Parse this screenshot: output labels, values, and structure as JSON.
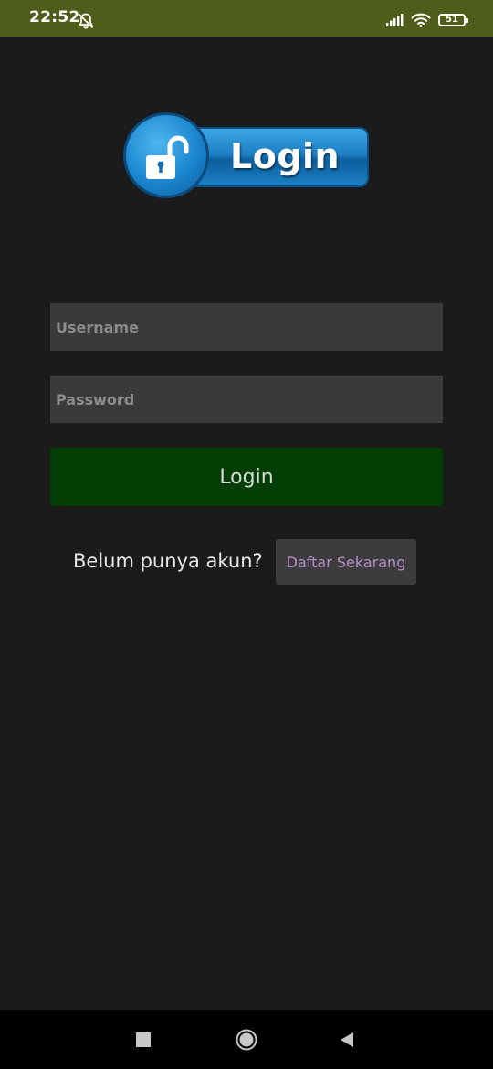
{
  "status_bar": {
    "time": "22:52",
    "battery": "51",
    "icons": [
      "bell-off-icon",
      "signal-icon",
      "wifi-icon",
      "battery-icon"
    ]
  },
  "logo": {
    "text": "Login",
    "icon": "unlocked-padlock-icon",
    "colors": {
      "primary": "#1d7fc4",
      "dark": "#0b4f84"
    }
  },
  "form": {
    "username_placeholder": "Username",
    "password_placeholder": "Password",
    "login_label": "Login"
  },
  "register": {
    "prompt": "Belum punya akun?",
    "button_label": "Daftar Sekarang"
  },
  "nav_bar": {
    "icons": [
      "recents-square-icon",
      "home-circle-icon",
      "back-triangle-icon"
    ]
  },
  "colors": {
    "background": "#1b1b1b",
    "status_bar": "#4e5d1a",
    "login_button": "#003e03",
    "input_bg": "#3a3a3a",
    "register_link_text": "#b58fc8"
  }
}
